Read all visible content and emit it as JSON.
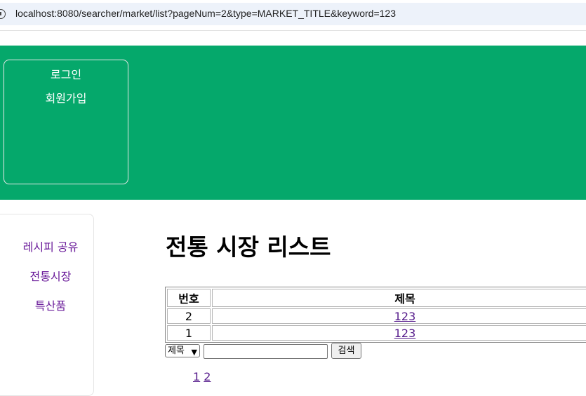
{
  "browser": {
    "url": "localhost:8080/searcher/market/list?pageNum=2&type=MARKET_TITLE&keyword=123"
  },
  "header": {
    "login_label": "로그인",
    "signup_label": "회원가입",
    "background_color": "#05a86b"
  },
  "sidebar": {
    "items": [
      {
        "label": "레시피 공유"
      },
      {
        "label": "전통시장"
      },
      {
        "label": "특산품"
      }
    ]
  },
  "main": {
    "title": "전통 시장 리스트",
    "table": {
      "headers": [
        "번호",
        "제목"
      ],
      "rows": [
        {
          "no": "2",
          "title": "123"
        },
        {
          "no": "1",
          "title": "123"
        }
      ]
    },
    "search": {
      "type_selected": "제목",
      "keyword_value": "",
      "button_label": "검색"
    },
    "pagination": {
      "pages": [
        "1",
        "2"
      ]
    }
  }
}
